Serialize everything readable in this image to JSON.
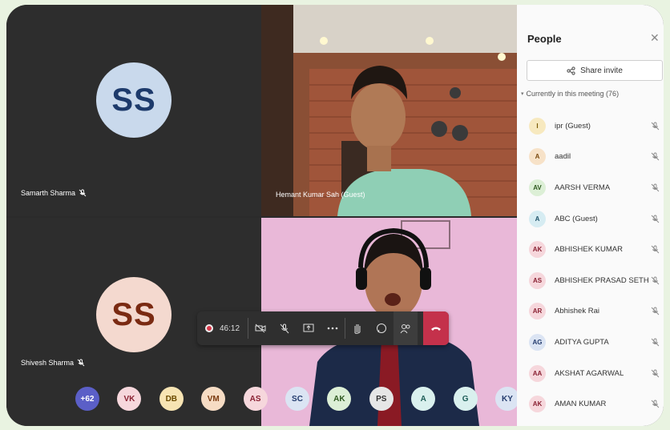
{
  "tiles": [
    {
      "name": "Samarth Sharma",
      "initials": "SS",
      "avatar_bg": "#c9d9ec",
      "avatar_fg": "#1d3a6b"
    },
    {
      "name": "Hemant Kumar Sah (Guest)"
    },
    {
      "name": "Shivesh Sharma",
      "initials": "SS",
      "avatar_bg": "#f4d9cf",
      "avatar_fg": "#7a2a12"
    },
    {
      "name": ""
    }
  ],
  "toolbar": {
    "timer": "46:12",
    "buttons": [
      "camera-off-icon",
      "mic-off-icon",
      "share-screen-icon",
      "more-icon",
      "raise-hand-icon",
      "chat-icon",
      "people-icon",
      "hang-up-icon"
    ]
  },
  "avatar_strip": [
    {
      "label": "+62",
      "bg": "#5b5fc7",
      "fg": "#ffffff"
    },
    {
      "label": "VK",
      "bg": "#f6d7dc",
      "fg": "#8a2233"
    },
    {
      "label": "DB",
      "bg": "#f7e4b3",
      "fg": "#6b4a00"
    },
    {
      "label": "VM",
      "bg": "#f6dcc4",
      "fg": "#7a3a10"
    },
    {
      "label": "AS",
      "bg": "#f6d7dc",
      "fg": "#8a2233"
    },
    {
      "label": "SC",
      "bg": "#dbe4f3",
      "fg": "#243c6e"
    },
    {
      "label": "AK",
      "bg": "#dcefd6",
      "fg": "#2f5a20"
    },
    {
      "label": "PS",
      "bg": "#e6e6e6",
      "fg": "#333333"
    },
    {
      "label": "A",
      "bg": "#d9f0ee",
      "fg": "#1f5e59"
    },
    {
      "label": "G",
      "bg": "#d9f0ee",
      "fg": "#1f5e59"
    },
    {
      "label": "KY",
      "bg": "#dbe4f3",
      "fg": "#243c6e"
    }
  ],
  "panel": {
    "title": "People",
    "share_label": "Share invite",
    "section_label": "Currently in this meeting (76)",
    "people": [
      {
        "initials": "I",
        "name": "ipr (Guest)",
        "bg": "#f7e9bf",
        "fg": "#7a5a00"
      },
      {
        "initials": "A",
        "name": "aadil",
        "bg": "#f7e2c8",
        "fg": "#7a4a10"
      },
      {
        "initials": "AV",
        "name": "AARSH VERMA",
        "bg": "#dcefd6",
        "fg": "#2f5a20"
      },
      {
        "initials": "A",
        "name": "ABC (Guest)",
        "bg": "#d6ecf2",
        "fg": "#1f5369"
      },
      {
        "initials": "AK",
        "name": "ABHISHEK KUMAR",
        "bg": "#f6d7dc",
        "fg": "#8a2233"
      },
      {
        "initials": "AS",
        "name": "ABHISHEK PRASAD SETH",
        "bg": "#f6d7dc",
        "fg": "#8a2233"
      },
      {
        "initials": "AR",
        "name": "Abhishek Rai",
        "bg": "#f6d7dc",
        "fg": "#8a2233"
      },
      {
        "initials": "AG",
        "name": "ADITYA GUPTA",
        "bg": "#dbe4f3",
        "fg": "#243c6e"
      },
      {
        "initials": "AA",
        "name": "AKSHAT AGARWAL",
        "bg": "#f6d7dc",
        "fg": "#8a2233"
      },
      {
        "initials": "AK",
        "name": "AMAN KUMAR",
        "bg": "#f6d7dc",
        "fg": "#8a2233"
      }
    ]
  }
}
